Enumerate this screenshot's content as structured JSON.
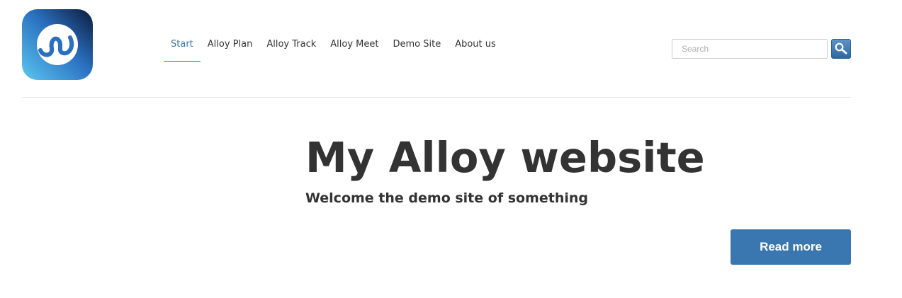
{
  "header": {
    "logo_icon": "alloy-logo-icon",
    "nav": [
      {
        "label": "Start",
        "active": true
      },
      {
        "label": "Alloy Plan",
        "active": false
      },
      {
        "label": "Alloy Track",
        "active": false
      },
      {
        "label": "Alloy Meet",
        "active": false
      },
      {
        "label": "Demo Site",
        "active": false
      },
      {
        "label": "About us",
        "active": false
      }
    ],
    "search": {
      "placeholder": "Search",
      "value": "",
      "button_icon": "magnifier-icon"
    }
  },
  "hero": {
    "title": "My Alloy website",
    "subtitle": "Welcome the demo site of something",
    "button_label": "Read more"
  },
  "colors": {
    "accent": "#3a74ad",
    "button": "#3a77b0",
    "text": "#333333"
  }
}
